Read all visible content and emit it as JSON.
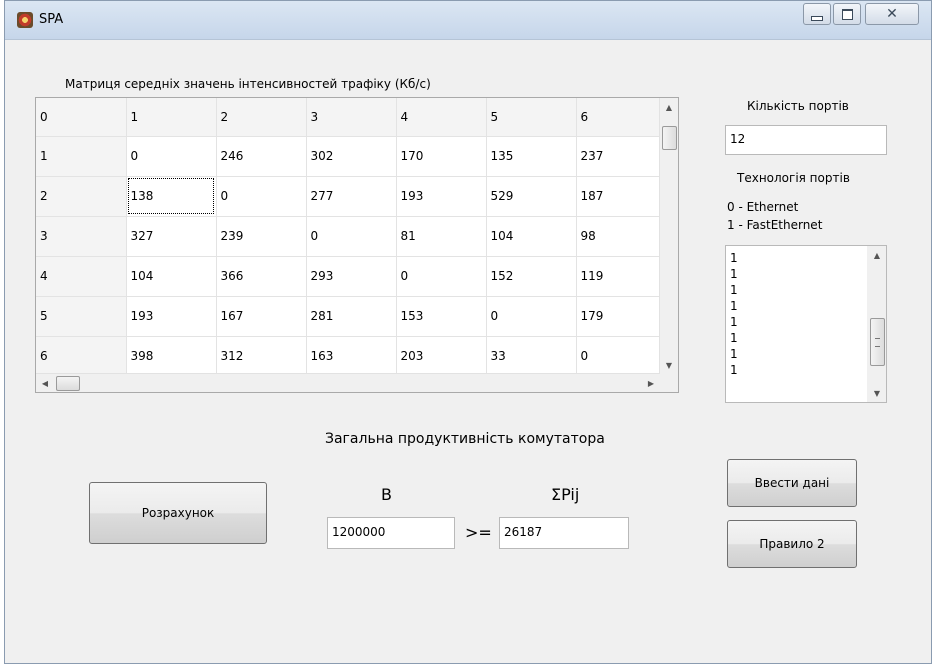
{
  "window": {
    "title": "SPA"
  },
  "matrix": {
    "label": "Матриця середніх значень інтенсивностей трафіку (Кб/с)",
    "header": [
      "0",
      "1",
      "2",
      "3",
      "4",
      "5",
      "6"
    ],
    "rows": [
      [
        "1",
        "0",
        "246",
        "302",
        "170",
        "135",
        "237"
      ],
      [
        "2",
        "138",
        "0",
        "277",
        "193",
        "529",
        "187"
      ],
      [
        "3",
        "327",
        "239",
        "0",
        "81",
        "104",
        "98"
      ],
      [
        "4",
        "104",
        "366",
        "293",
        "0",
        "152",
        "119"
      ],
      [
        "5",
        "193",
        "167",
        "281",
        "153",
        "0",
        "179"
      ],
      [
        "6",
        "398",
        "312",
        "163",
        "203",
        "33",
        "0"
      ]
    ]
  },
  "ports": {
    "label": "Кількість портів",
    "value": "12"
  },
  "tech": {
    "label": "Технологія портів",
    "legend0": "0 - Ethernet",
    "legend1": "1 - FastEthernet",
    "items": [
      "1",
      "1",
      "1",
      "1",
      "1",
      "1",
      "1",
      "1"
    ]
  },
  "perf": {
    "title": "Загальна продуктивність комутатора",
    "b_label": "B",
    "sum_label": "ΣPij",
    "gte": ">=",
    "b_value": "1200000",
    "sum_value": "26187"
  },
  "buttons": {
    "calc": "Розрахунок",
    "enter": "Ввести дані",
    "rule": "Правило 2"
  }
}
